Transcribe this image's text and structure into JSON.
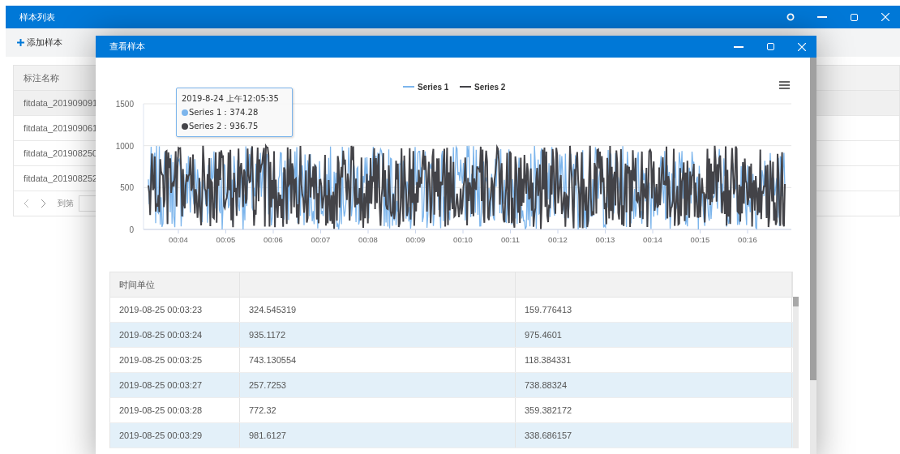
{
  "main_window": {
    "title": "样本列表"
  },
  "toolbar": {
    "add_button": "添加样本"
  },
  "sample_table": {
    "columns": [
      "标注名称"
    ],
    "rows": [
      {
        "name": "fitdata_201909091",
        "selected": true
      },
      {
        "name": "fitdata_201909061",
        "selected": false
      },
      {
        "name": "fitdata_201908250",
        "selected": false
      },
      {
        "name": "fitdata_201908252",
        "selected": false
      }
    ]
  },
  "pagination": {
    "goto_label": "到第"
  },
  "dialog": {
    "title": "查看样本",
    "chart": {
      "legend": [
        {
          "name": "Series 1",
          "color": "#7cb5ec"
        },
        {
          "name": "Series 2",
          "color": "#434348"
        }
      ],
      "y_ticks": [
        "1500",
        "1000",
        "500",
        "0"
      ],
      "x_ticks": [
        "00:04",
        "00:05",
        "00:06",
        "00:07",
        "00:08",
        "00:09",
        "00:10",
        "00:11",
        "00:12",
        "00:13",
        "00:14",
        "00:15",
        "00:16"
      ],
      "tooltip": {
        "title": "2019-8-24 上午12:05:35",
        "items": [
          {
            "text": "Series 1：374.28",
            "color": "#7cb5ec"
          },
          {
            "text": "Series 2：936.75",
            "color": "#434348"
          }
        ]
      }
    },
    "table": {
      "columns": [
        "时间单位"
      ],
      "rows": [
        [
          "2019-08-25 00:03:23",
          "324.545319",
          "159.776413"
        ],
        [
          "2019-08-25 00:03:24",
          "935.1172",
          "975.4601"
        ],
        [
          "2019-08-25 00:03:25",
          "743.130554",
          "118.384331"
        ],
        [
          "2019-08-25 00:03:27",
          "257.7253",
          "738.88324"
        ],
        [
          "2019-08-25 00:03:28",
          "772.32",
          "359.382172"
        ],
        [
          "2019-08-25 00:03:29",
          "981.6127",
          "338.686157"
        ]
      ]
    }
  }
}
